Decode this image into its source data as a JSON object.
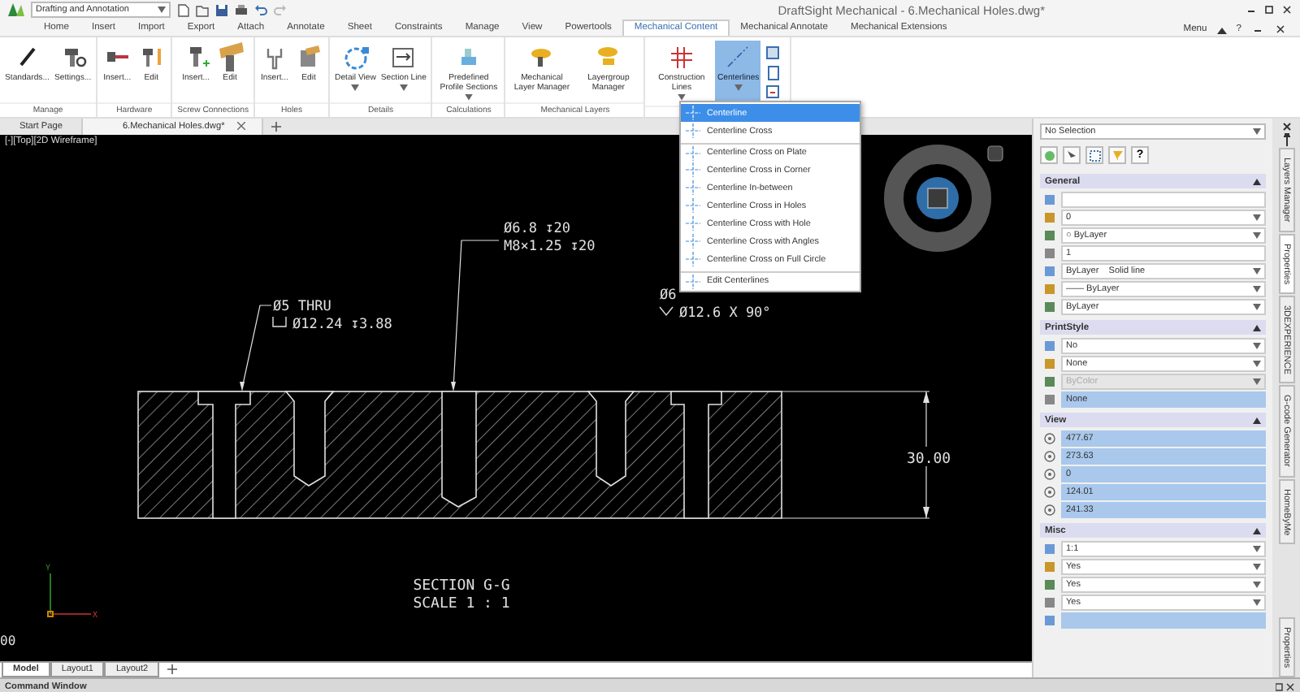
{
  "title_bar": {
    "workspace": "Drafting and Annotation",
    "title": "DraftSight Mechanical - 6.Mechanical Holes.dwg*"
  },
  "menu_tabs": [
    {
      "label": "Home",
      "selected": false
    },
    {
      "label": "Insert",
      "selected": false
    },
    {
      "label": "Import",
      "selected": false
    },
    {
      "label": "Export",
      "selected": false
    },
    {
      "label": "Attach",
      "selected": false
    },
    {
      "label": "Annotate",
      "selected": false
    },
    {
      "label": "Sheet",
      "selected": false
    },
    {
      "label": "Constraints",
      "selected": false
    },
    {
      "label": "Manage",
      "selected": false
    },
    {
      "label": "View",
      "selected": false
    },
    {
      "label": "Powertools",
      "selected": false
    },
    {
      "label": "Mechanical Content",
      "selected": true
    },
    {
      "label": "Mechanical Annotate",
      "selected": false
    },
    {
      "label": "Mechanical Extensions",
      "selected": false
    }
  ],
  "menu_right": {
    "label": "Menu",
    "help": "?"
  },
  "ribbon_groups": [
    {
      "label": "Manage",
      "buttons": [
        {
          "label": "Standards...",
          "dropdown": false,
          "pressed": false
        },
        {
          "label": "Settings...",
          "dropdown": false,
          "pressed": false
        }
      ]
    },
    {
      "label": "Hardware",
      "buttons": [
        {
          "label": "Insert...",
          "dropdown": false,
          "pressed": false
        },
        {
          "label": "Edit",
          "dropdown": false,
          "pressed": false
        }
      ]
    },
    {
      "label": "Screw Connections",
      "buttons": [
        {
          "label": "Insert...",
          "dropdown": false,
          "pressed": false
        },
        {
          "label": "Edit",
          "dropdown": false,
          "pressed": false
        }
      ]
    },
    {
      "label": "Holes",
      "buttons": [
        {
          "label": "Insert...",
          "dropdown": false,
          "pressed": false
        },
        {
          "label": "Edit",
          "dropdown": false,
          "pressed": false
        }
      ]
    },
    {
      "label": "Details",
      "buttons": [
        {
          "label": "Detail View",
          "dropdown": true,
          "pressed": false
        },
        {
          "label": "Section Line",
          "dropdown": true,
          "pressed": false
        }
      ]
    },
    {
      "label": "Calculations",
      "buttons": [
        {
          "label": "Predefined Profile Sections",
          "dropdown": true,
          "pressed": false
        }
      ]
    },
    {
      "label": "Mechanical Layers",
      "buttons": [
        {
          "label": "Mechanical Layer Manager",
          "dropdown": false,
          "pressed": false
        },
        {
          "label": "Layergroup Manager",
          "dropdown": false,
          "pressed": false
        }
      ]
    },
    {
      "buttons": [
        {
          "label": "Construction Lines",
          "dropdown": true,
          "pressed": false
        },
        {
          "label": "Centerlines",
          "dropdown": true,
          "pressed": true
        }
      ]
    }
  ],
  "doc_tabs": [
    {
      "label": "Start Page",
      "selected": false,
      "closable": false
    },
    {
      "label": "6.Mechanical Holes.dwg*",
      "selected": true,
      "closable": true
    }
  ],
  "viewport": {
    "label": "[-][Top][2D Wireframe]"
  },
  "drawing": {
    "callouts": [
      {
        "lines": [
          {
            "kind": "plain",
            "text": "Ø5 THRU"
          },
          {
            "kind": "counterbore",
            "text": "Ø12.24 ↧3.88"
          }
        ]
      },
      {
        "lines": [
          {
            "kind": "plain",
            "text": "Ø6.8 ↧20"
          },
          {
            "kind": "plain",
            "text": "M8×1.25 ↧20"
          }
        ]
      },
      {
        "lines": [
          {
            "kind": "plain",
            "text": "Ø6"
          },
          {
            "kind": "countersink",
            "text": "Ø12.6 X 90°"
          }
        ]
      }
    ],
    "dimension": "30.00",
    "section_title": "SECTION G-G",
    "scale": "SCALE 1 : 1",
    "axis_x": "X",
    "axis_y": "Y",
    "edge_text": "00"
  },
  "centerlines_menu": [
    {
      "label": "Centerline",
      "selected": true,
      "separator_before": false
    },
    {
      "label": "Centerline Cross",
      "selected": false,
      "separator_before": false
    },
    {
      "label": "Centerline Cross on Plate",
      "selected": false,
      "separator_before": true
    },
    {
      "label": "Centerline Cross in Corner",
      "selected": false,
      "separator_before": false
    },
    {
      "label": "Centerline In-between",
      "selected": false,
      "separator_before": false
    },
    {
      "label": "Centerline Cross in Holes",
      "selected": false,
      "separator_before": false
    },
    {
      "label": "Centerline Cross with Hole",
      "selected": false,
      "separator_before": false
    },
    {
      "label": "Centerline Cross with Angles",
      "selected": false,
      "separator_before": false
    },
    {
      "label": "Centerline Cross on Full Circle",
      "selected": false,
      "separator_before": false
    },
    {
      "label": "Edit Centerlines",
      "selected": false,
      "separator_before": true
    }
  ],
  "properties": {
    "selector": "No Selection",
    "help": "?",
    "sections": [
      {
        "title": "General",
        "expanded": true,
        "rows": [
          {
            "kind": "text",
            "highlighted": false,
            "disabled": false
          },
          {
            "kind": "dropdown",
            "value": "0",
            "highlighted": false,
            "disabled": false
          },
          {
            "kind": "dropdown",
            "value": "○ ByLayer",
            "highlighted": false,
            "disabled": false
          },
          {
            "kind": "text",
            "value": "1",
            "highlighted": false,
            "disabled": false
          },
          {
            "kind": "dropdown",
            "value": "ByLayer    Solid line",
            "highlighted": false,
            "disabled": false
          },
          {
            "kind": "dropdown",
            "value": "—— ByLayer",
            "highlighted": false,
            "disabled": false
          },
          {
            "kind": "dropdown",
            "value": "ByLayer",
            "highlighted": false,
            "disabled": false
          }
        ]
      },
      {
        "title": "PrintStyle",
        "expanded": true,
        "rows": [
          {
            "kind": "dropdown",
            "value": "No",
            "highlighted": false,
            "disabled": false
          },
          {
            "kind": "dropdown",
            "value": "None",
            "highlighted": false,
            "disabled": false
          },
          {
            "kind": "dropdown",
            "value": "ByColor",
            "highlighted": false,
            "disabled": true
          },
          {
            "kind": "text",
            "value": "None",
            "highlighted": true,
            "disabled": false
          }
        ]
      },
      {
        "title": "View",
        "expanded": true,
        "rows": [
          {
            "kind": "text",
            "value": "477.67",
            "highlighted": true,
            "disabled": false
          },
          {
            "kind": "text",
            "value": "273.63",
            "highlighted": true,
            "disabled": false
          },
          {
            "kind": "text",
            "value": "0",
            "highlighted": true,
            "disabled": false
          },
          {
            "kind": "text",
            "value": "124.01",
            "highlighted": true,
            "disabled": false
          },
          {
            "kind": "text",
            "value": "241.33",
            "highlighted": true,
            "disabled": false
          }
        ]
      },
      {
        "title": "Misc",
        "expanded": true,
        "rows": [
          {
            "kind": "dropdown",
            "value": "1:1",
            "highlighted": false,
            "disabled": false
          },
          {
            "kind": "dropdown",
            "value": "Yes",
            "highlighted": false,
            "disabled": false
          },
          {
            "kind": "dropdown",
            "value": "Yes",
            "highlighted": false,
            "disabled": false
          },
          {
            "kind": "dropdown",
            "value": "Yes",
            "highlighted": false,
            "disabled": false
          },
          {
            "kind": "text",
            "highlighted": true,
            "disabled": false
          }
        ]
      }
    ]
  },
  "side_tabs": [
    {
      "label": "Layers Manager",
      "selected": false
    },
    {
      "label": "Properties",
      "selected": true
    },
    {
      "label": "3DEXPERIENCE",
      "selected": false
    },
    {
      "label": "G-code Generator",
      "selected": false
    },
    {
      "label": "HomeByMe",
      "selected": false
    }
  ],
  "side_bottom_tab": {
    "label": "Properties"
  },
  "layout_tabs": [
    {
      "label": "Model",
      "selected": true
    },
    {
      "label": "Layout1",
      "selected": false
    },
    {
      "label": "Layout2",
      "selected": false
    }
  ],
  "command_window": {
    "title": "Command Window"
  }
}
